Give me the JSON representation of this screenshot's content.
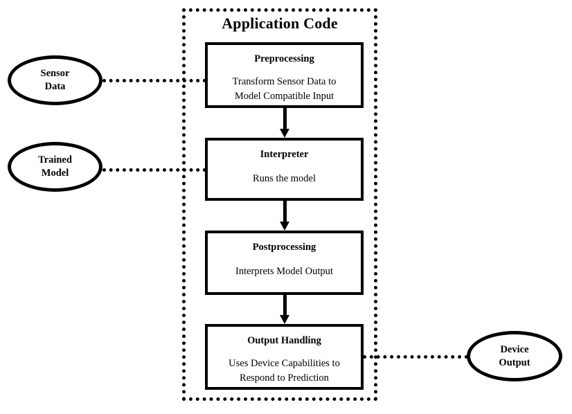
{
  "diagram": {
    "title": "Application Code",
    "container_style": "dotted-border",
    "colors": {
      "stroke": "#000000",
      "fill": "#ffffff",
      "text": "#000000"
    },
    "process_boxes": [
      {
        "id": "preprocessing",
        "title": "Preprocessing",
        "description_lines": [
          "Transform Sensor Data to",
          "Model Compatible Input"
        ]
      },
      {
        "id": "interpreter",
        "title": "Interpreter",
        "description_lines": [
          "Runs the model"
        ]
      },
      {
        "id": "postprocessing",
        "title": "Postprocessing",
        "description_lines": [
          "Interprets Model Output"
        ]
      },
      {
        "id": "output-handling",
        "title": "Output Handling",
        "description_lines": [
          "Uses Device Capabilities to",
          "Respond to Prediction"
        ]
      }
    ],
    "ellipse_nodes": [
      {
        "id": "sensor-data",
        "label_lines": [
          "Sensor",
          "Data"
        ],
        "side": "left",
        "connects_to": "preprocessing"
      },
      {
        "id": "trained-model",
        "label_lines": [
          "Trained",
          "Model"
        ],
        "side": "left",
        "connects_to": "interpreter"
      },
      {
        "id": "device-output",
        "label_lines": [
          "Device",
          "Output"
        ],
        "side": "right",
        "connects_to": "output-handling"
      }
    ],
    "flow_arrows": [
      {
        "id": "arrow-1",
        "from": "preprocessing",
        "to": "interpreter",
        "direction": "down"
      },
      {
        "id": "arrow-2",
        "from": "interpreter",
        "to": "postprocessing",
        "direction": "down"
      },
      {
        "id": "arrow-3",
        "from": "postprocessing",
        "to": "output-handling",
        "direction": "down"
      }
    ],
    "dotted_connectors": [
      {
        "id": "conn-sensor",
        "from": "sensor-data",
        "to": "preprocessing"
      },
      {
        "id": "conn-model",
        "from": "trained-model",
        "to": "interpreter"
      },
      {
        "id": "conn-output",
        "from": "output-handling",
        "to": "device-output"
      }
    ]
  }
}
